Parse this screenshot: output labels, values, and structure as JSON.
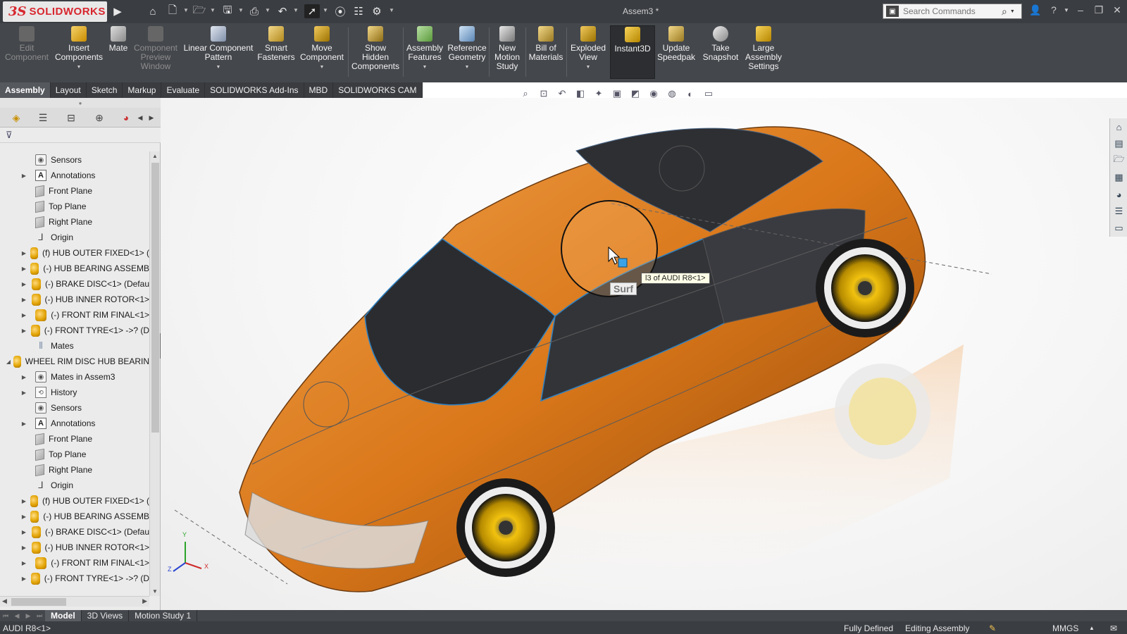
{
  "app": {
    "brand_ds": "3S",
    "brand_name": "SOLIDWORKS",
    "document_title": "Assem3 *"
  },
  "search": {
    "placeholder": "Search Commands"
  },
  "command_manager": {
    "items": [
      {
        "label": "Edit\nComponent",
        "enabled": false,
        "icon": "edit-component-icon"
      },
      {
        "label": "Insert\nComponents",
        "enabled": true,
        "icon": "insert-components-icon",
        "dropdown": true
      },
      {
        "label": "Mate",
        "enabled": true,
        "icon": "mate-icon"
      },
      {
        "label": "Component\nPreview\nWindow",
        "enabled": false,
        "icon": "component-preview-icon"
      },
      {
        "label": "Linear Component\nPattern",
        "enabled": true,
        "icon": "linear-pattern-icon",
        "dropdown": true
      },
      {
        "label": "Smart\nFasteners",
        "enabled": true,
        "icon": "smart-fasteners-icon"
      },
      {
        "label": "Move\nComponent",
        "enabled": true,
        "icon": "move-component-icon",
        "dropdown": true
      },
      {
        "label": "Show\nHidden\nComponents",
        "enabled": true,
        "icon": "show-hidden-icon"
      },
      {
        "label": "Assembly\nFeatures",
        "enabled": true,
        "icon": "assembly-features-icon",
        "dropdown": true
      },
      {
        "label": "Reference\nGeometry",
        "enabled": true,
        "icon": "reference-geometry-icon",
        "dropdown": true
      },
      {
        "label": "New\nMotion\nStudy",
        "enabled": true,
        "icon": "motion-study-icon"
      },
      {
        "label": "Bill of\nMaterials",
        "enabled": true,
        "icon": "bom-icon"
      },
      {
        "label": "Exploded\nView",
        "enabled": true,
        "icon": "exploded-view-icon",
        "dropdown": true
      },
      {
        "label": "Instant3D",
        "enabled": true,
        "icon": "instant3d-icon",
        "active": true
      },
      {
        "label": "Update\nSpeedpak",
        "enabled": true,
        "icon": "speedpak-icon"
      },
      {
        "label": "Take\nSnapshot",
        "enabled": true,
        "icon": "camera-icon"
      },
      {
        "label": "Large\nAssembly\nSettings",
        "enabled": true,
        "icon": "large-assembly-icon"
      }
    ]
  },
  "tabs": [
    "Assembly",
    "Layout",
    "Sketch",
    "Markup",
    "Evaluate",
    "SOLIDWORKS Add-Ins",
    "MBD",
    "SOLIDWORKS CAM"
  ],
  "active_tab": "Assembly",
  "feature_tree": {
    "nodes": [
      {
        "label": "Sensors",
        "icon": "sensor",
        "indent": 1,
        "expander": false
      },
      {
        "label": "Annotations",
        "icon": "annotation",
        "indent": 1,
        "expander": true
      },
      {
        "label": "Front Plane",
        "icon": "plane",
        "indent": 1,
        "expander": false
      },
      {
        "label": "Top Plane",
        "icon": "plane",
        "indent": 1,
        "expander": false
      },
      {
        "label": "Right Plane",
        "icon": "plane",
        "indent": 1,
        "expander": false
      },
      {
        "label": "Origin",
        "icon": "origin",
        "indent": 1,
        "expander": false
      },
      {
        "label": "(f) HUB OUTER FIXED<1> (",
        "icon": "part",
        "indent": 1,
        "expander": true
      },
      {
        "label": "(-) HUB BEARING ASSEMB",
        "icon": "assembly",
        "indent": 1,
        "expander": true
      },
      {
        "label": "(-) BRAKE DISC<1> (Defau",
        "icon": "part",
        "indent": 1,
        "expander": true
      },
      {
        "label": "(-) HUB INNER ROTOR<1>",
        "icon": "part",
        "indent": 1,
        "expander": true
      },
      {
        "label": "(-) FRONT RIM FINAL<1>",
        "icon": "part",
        "indent": 1,
        "expander": true
      },
      {
        "label": "(-) FRONT TYRE<1> ->? (D",
        "icon": "part",
        "indent": 1,
        "expander": true
      },
      {
        "label": "Mates",
        "icon": "mates",
        "indent": 1,
        "expander": false
      },
      {
        "label": "WHEEL RIM DISC HUB BEARIN",
        "icon": "assembly",
        "indent": 0,
        "expander": true,
        "expanded": true
      },
      {
        "label": "Mates in Assem3",
        "icon": "sensor",
        "indent": 1,
        "expander": true
      },
      {
        "label": "History",
        "icon": "history",
        "indent": 1,
        "expander": true
      },
      {
        "label": "Sensors",
        "icon": "sensor",
        "indent": 1,
        "expander": false
      },
      {
        "label": "Annotations",
        "icon": "annotation",
        "indent": 1,
        "expander": true
      },
      {
        "label": "Front Plane",
        "icon": "plane",
        "indent": 1,
        "expander": false
      },
      {
        "label": "Top Plane",
        "icon": "plane",
        "indent": 1,
        "expander": false
      },
      {
        "label": "Right Plane",
        "icon": "plane",
        "indent": 1,
        "expander": false
      },
      {
        "label": "Origin",
        "icon": "origin",
        "indent": 1,
        "expander": false
      },
      {
        "label": "(f) HUB OUTER FIXED<1> (",
        "icon": "part",
        "indent": 1,
        "expander": true
      },
      {
        "label": "(-) HUB BEARING ASSEMB",
        "icon": "assembly",
        "indent": 1,
        "expander": true
      },
      {
        "label": "(-) BRAKE DISC<1> (Defau",
        "icon": "part",
        "indent": 1,
        "expander": true
      },
      {
        "label": "(-) HUB INNER ROTOR<1>",
        "icon": "part",
        "indent": 1,
        "expander": true
      },
      {
        "label": "(-) FRONT RIM FINAL<1>",
        "icon": "part",
        "indent": 1,
        "expander": true
      },
      {
        "label": "(-) FRONT TYRE<1> ->? (D",
        "icon": "part",
        "indent": 1,
        "expander": true
      }
    ]
  },
  "viewport": {
    "tooltip": "l3 of AUDI R8<1>",
    "tooltip_partial": "Surf",
    "triad": {
      "x": "X",
      "y": "Y",
      "z": "Z"
    },
    "colors": {
      "body": "#d9771a",
      "glass": "#2e2f33",
      "rim": "#f2c20f"
    }
  },
  "bottom_tabs": [
    "Model",
    "3D Views",
    "Motion Study 1"
  ],
  "active_bottom_tab": "Model",
  "status": {
    "left": "AUDI R8<1>",
    "defined": "Fully Defined",
    "mode": "Editing Assembly",
    "units": "MMGS"
  }
}
